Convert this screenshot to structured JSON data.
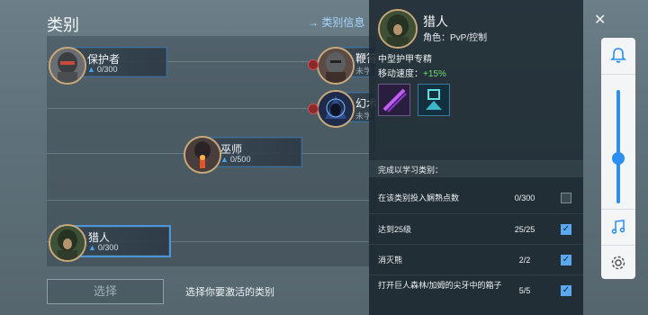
{
  "left": {
    "title": "类别",
    "class_info_link": "→ 类别信息"
  },
  "nodes": [
    {
      "name": "保护者",
      "progress": "0/300"
    },
    {
      "name": "鞭笞",
      "progress": "未学"
    },
    {
      "name": "幻术",
      "progress": "未学"
    },
    {
      "name": "巫师",
      "progress": "0/500"
    },
    {
      "name": "猎人",
      "progress": "0/300"
    }
  ],
  "footer": {
    "select_button": "选择",
    "hint": "选择你要激活的类别"
  },
  "info": {
    "class_name": "猎人",
    "role": "角色：PvP/控制",
    "passive_title": "中型护甲专精",
    "move_speed_label": "移动速度：",
    "move_speed_value": "+15%",
    "requirements_title": "完成以学习类别：",
    "requirements": [
      {
        "label": "在该类别投入娴熟点数",
        "value": "0/300",
        "done": false
      },
      {
        "label": "达到25级",
        "value": "25/25",
        "done": true
      },
      {
        "label": "消灭熊",
        "value": "2/2",
        "done": true
      },
      {
        "label": "打开巨人森林/加姆的尖牙中的箱子",
        "value": "5/5",
        "done": true
      }
    ]
  },
  "side": {
    "close": "✕",
    "volume_level": 0.4
  },
  "colors": {
    "accent": "#4ba3e8",
    "bonus_green": "#6fdc6f",
    "frame_blue": "#3a6fa0",
    "avatar_gold": "#c9a97a"
  }
}
